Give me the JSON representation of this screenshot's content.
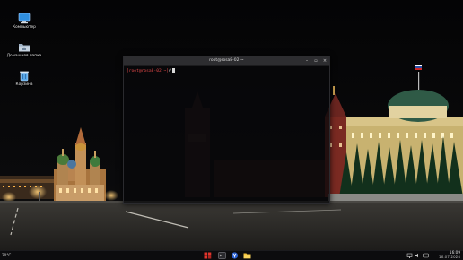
{
  "desktop": {
    "icons": [
      {
        "label": "Компьютер",
        "icon": "computer-icon"
      },
      {
        "label": "Домашняя папка",
        "icon": "home-folder-icon"
      },
      {
        "label": "Корзина",
        "icon": "trash-icon"
      }
    ]
  },
  "terminal": {
    "title": "root@rosa8-02:~",
    "prompt": "[root@rosa8-02 ~]",
    "prompt_symbol": "#",
    "buttons": {
      "minimize": "–",
      "maximize": "▫",
      "close": "×"
    }
  },
  "taskbar": {
    "weather": "20°C",
    "apps": [
      "rosa-menu-icon",
      "terminal-icon",
      "file-manager-icon",
      "yandex-browser-icon",
      "folder-icon"
    ],
    "tray": [
      "network-icon",
      "volume-icon",
      "keyboard-icon"
    ],
    "time": "16:09",
    "date": "16.07.2024"
  },
  "colors": {
    "accent": "#e0342c",
    "prompt": "#e04848"
  }
}
